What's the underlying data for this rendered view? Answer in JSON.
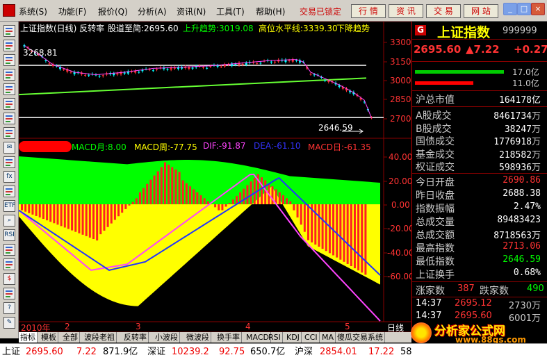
{
  "menu": {
    "items": [
      "系统(S)",
      "功能(F)",
      "报价(Q)",
      "分析(A)",
      "资讯(N)",
      "工具(T)",
      "帮助(H)"
    ],
    "locked": "交易已锁定",
    "buttons": [
      "行 情",
      "资 讯",
      "交 易",
      "网 站"
    ]
  },
  "toolbar": {
    "icons": [
      "grid-icon",
      "list-icon",
      "kline-icon",
      "calendar-icon",
      "table-icon",
      "report-icon",
      "doc-icon",
      "layers-icon",
      "mail-icon",
      "users-icon",
      "fx-icon",
      "chart-icon",
      "etf-icon",
      "zoom-icon",
      "rsi-icon",
      "news-icon",
      "box-icon",
      "dollar-icon",
      "settings-icon",
      "help-icon",
      "pen-icon"
    ]
  },
  "chart_header": {
    "title": "上证指数(日线) 反转率",
    "lowest": "股道至简:2695.60",
    "uptrend": "上升趋势:3019.08",
    "highline": "高位水平线:3339.30",
    "downtrend": "下降趋势"
  },
  "macd_header": {
    "month": "MACD月:8.00",
    "week": "MACD周:-77.75",
    "dif": "DIF:-91.87",
    "dea": "DEA:-61.10",
    "day": "MACD日:-61.35"
  },
  "upper_axis": [
    "3300",
    "3150",
    "3000",
    "2850",
    "2700"
  ],
  "lower_axis": [
    "40.00",
    "20.00",
    "0.00",
    "-20.00",
    "-40.00",
    "-60.00"
  ],
  "annotations": {
    "high": "3268.81",
    "low": "2646.59"
  },
  "xaxis": {
    "labels": [
      "2010年",
      "2",
      "3",
      "4",
      "5"
    ],
    "period": "日线"
  },
  "tabs": [
    "指标",
    "模板",
    "全部",
    "波段老祖",
    "反转率",
    "小波段",
    "微波段",
    "换手率",
    "MACD",
    "RSI",
    "KDJ",
    "CCI",
    "MA",
    "傻瓜交易系统"
  ],
  "quote": {
    "badge": "G",
    "name": "上证指数",
    "code": "999999",
    "price": "2695.60",
    "change": "▲7.22",
    "pct": "+0.27",
    "buy_amount": "17.0亿",
    "sell_amount": "11.0亿",
    "market_cap_label": "沪总市值",
    "market_cap_value": "164178亿",
    "rows": [
      {
        "label": "A股成交",
        "value": "8461734",
        "unit": "万"
      },
      {
        "label": "B股成交",
        "value": "38247",
        "unit": "万"
      },
      {
        "label": "国债成交",
        "value": "1776918",
        "unit": "万"
      },
      {
        "label": "基金成交",
        "value": "218582",
        "unit": "万"
      },
      {
        "label": "权证成交",
        "value": "598936",
        "unit": "万"
      }
    ],
    "stats": [
      {
        "label": "今日开盘",
        "value": "2690.86",
        "color": "#ff3333"
      },
      {
        "label": "昨日收盘",
        "value": "2688.38",
        "color": "#ffffff"
      },
      {
        "label": "指数振幅",
        "value": "2.47%",
        "color": "#ffffff"
      },
      {
        "label": "总成交量",
        "value": "89483423",
        "color": "#ffffff"
      },
      {
        "label": "总成交额",
        "value": "8718563万",
        "color": "#ffffff"
      },
      {
        "label": "最高指数",
        "value": "2713.06",
        "color": "#ff3333"
      },
      {
        "label": "最低指数",
        "value": "2646.59",
        "color": "#00ff00"
      },
      {
        "label": "上证换手",
        "value": "0.68%",
        "color": "#ffffff"
      }
    ],
    "advance_label": "涨家数",
    "advance_value": "387",
    "decline_label": "跌家数",
    "decline_value": "490",
    "ticks": [
      {
        "time": "14:37",
        "price": "2695.12",
        "vol": "2730万"
      },
      {
        "time": "14:37",
        "price": "2695.60",
        "vol": "6001万"
      }
    ]
  },
  "statusbar": {
    "sh_label": "上证",
    "sh_price": "2695.60",
    "sh_chg": "7.22",
    "sh_amt": "871.9亿",
    "sz_label": "深证",
    "sz_price": "10239.2",
    "sz_chg": "92.75",
    "sz_amt": "650.7亿",
    "hs_label": "沪深",
    "hs_price": "2854.01",
    "hs_chg": "17.22",
    "hs_amt": "58"
  },
  "watermark": {
    "text": "分析家公式网",
    "url": "www.88gs.com"
  },
  "colors": {
    "up": "#ff3333",
    "down": "#00ff00",
    "accent": "#ffff00",
    "grid": "#800000"
  }
}
